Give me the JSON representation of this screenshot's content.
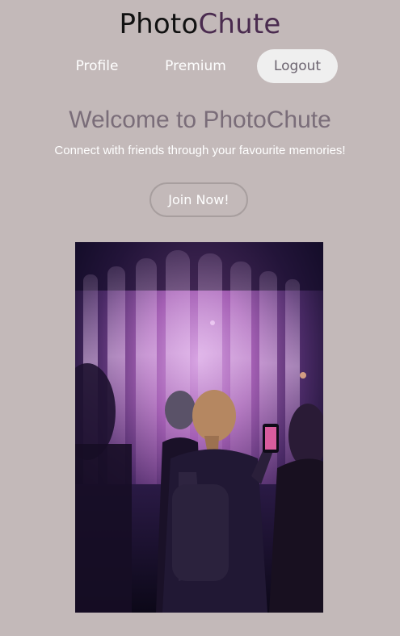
{
  "header": {
    "logo_part1": "Photo",
    "logo_part2": "Chute",
    "logo_colors": {
      "part1": "#111111",
      "part2": "#4a2b4f"
    }
  },
  "nav": {
    "profile_label": "Profile",
    "premium_label": "Premium",
    "logout_label": "Logout"
  },
  "hero_text": {
    "title": "Welcome to PhotoChute",
    "tagline": "Connect with friends through your favourite memories!",
    "cta_label": "Join Now!"
  },
  "colors": {
    "background": "#c3b9b9",
    "title": "#7a6d79",
    "logout_bg": "#efefef"
  }
}
